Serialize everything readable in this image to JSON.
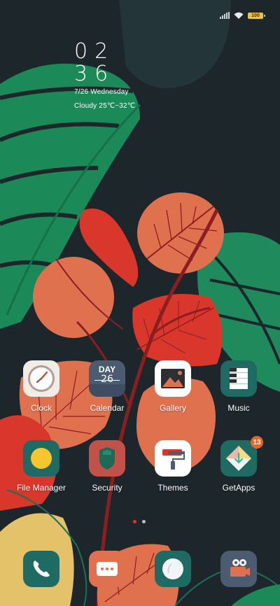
{
  "status": {
    "battery": "100"
  },
  "clock": {
    "hour": "02",
    "minute": "36",
    "date": "7/26 Wednesday",
    "weather": "Cloudy 25℃~32℃"
  },
  "calendar_icon": {
    "weekday": "DAY",
    "day": "26"
  },
  "apps": [
    {
      "label": "Clock"
    },
    {
      "label": "Calendar"
    },
    {
      "label": "Gallery"
    },
    {
      "label": "Music"
    },
    {
      "label": "File Manager"
    },
    {
      "label": "Security"
    },
    {
      "label": "Themes"
    },
    {
      "label": "GetApps",
      "badge": "13"
    }
  ],
  "dock": [
    {
      "icon": "phone-icon"
    },
    {
      "icon": "messages-icon"
    },
    {
      "icon": "browser-icon"
    },
    {
      "icon": "camera-icon"
    }
  ],
  "page_indicator": {
    "pages": 2,
    "current": 1
  },
  "colors": {
    "background": "#1d262a",
    "leaf_green": "#1f8a5a",
    "leaf_orange": "#e0714f",
    "leaf_red": "#d9372c",
    "badge": "#f0641e",
    "teal_icon": "#1f6b63"
  }
}
